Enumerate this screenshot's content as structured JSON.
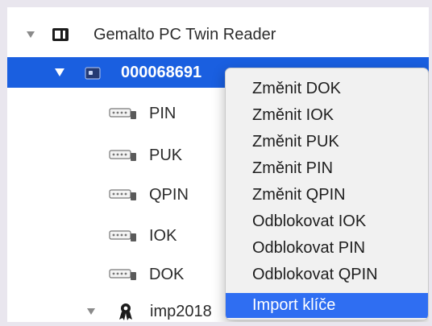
{
  "tree": {
    "reader": {
      "label": "Gemalto PC Twin Reader",
      "icon": "card-reader-icon",
      "expanded": true
    },
    "card": {
      "label": "000068691",
      "icon": "smart-card-icon",
      "expanded": true,
      "selected": true
    },
    "children": [
      {
        "label": "PIN",
        "icon": "key-icon"
      },
      {
        "label": "PUK",
        "icon": "key-icon"
      },
      {
        "label": "QPIN",
        "icon": "key-icon"
      },
      {
        "label": "IOK",
        "icon": "key-icon"
      },
      {
        "label": "DOK",
        "icon": "key-icon"
      }
    ],
    "imp": {
      "label": "imp2018",
      "icon": "certificate-icon",
      "expanded": true
    }
  },
  "context_menu": {
    "items": [
      {
        "label": "Změnit DOK"
      },
      {
        "label": "Změnit IOK"
      },
      {
        "label": "Změnit PUK"
      },
      {
        "label": "Změnit PIN"
      },
      {
        "label": "Změnit QPIN"
      },
      {
        "label": "Odblokovat IOK"
      },
      {
        "label": "Odblokovat PIN"
      },
      {
        "label": "Odblokovat QPIN"
      },
      {
        "label": "Import klíče",
        "highlighted": true
      }
    ]
  },
  "colors": {
    "selection": "#1a5fe0",
    "menu_highlight": "#2f6ef2",
    "menu_background": "#f1f1f1"
  }
}
